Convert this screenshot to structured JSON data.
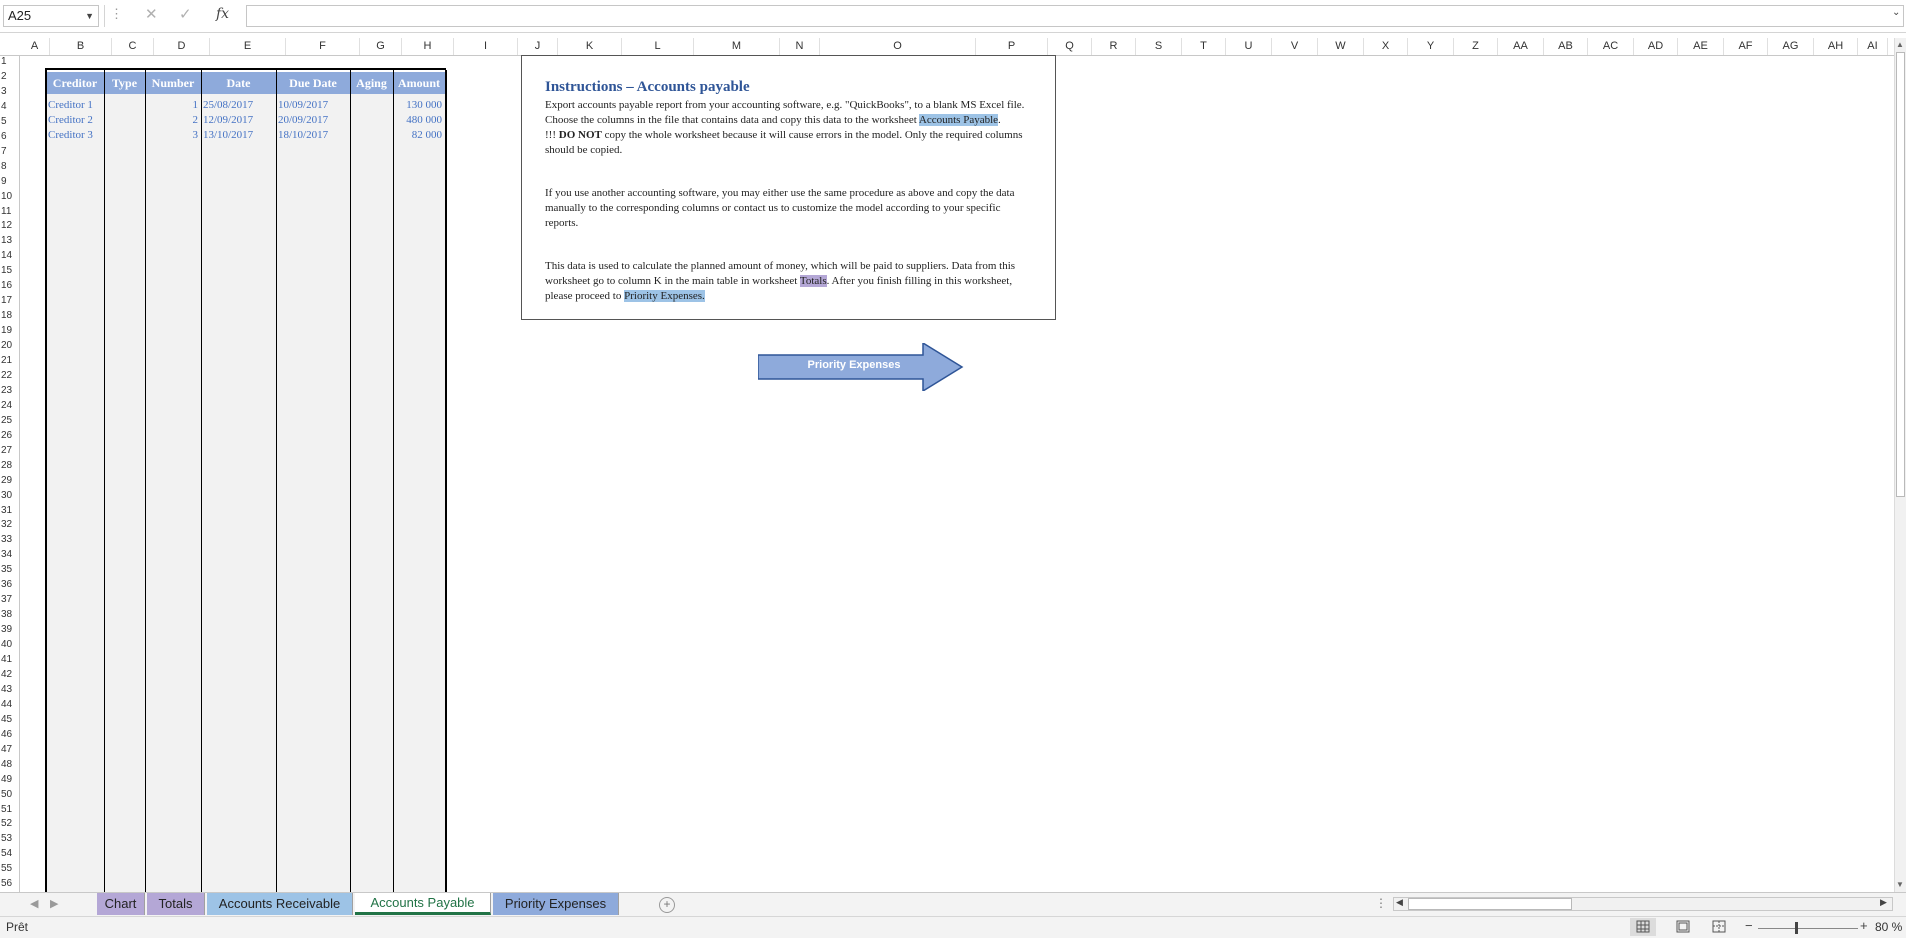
{
  "formula_bar": {
    "name_box": "A25",
    "cancel_icon": "✕",
    "enter_icon": "✓",
    "fx_label": "fx",
    "formula_value": ""
  },
  "columns": [
    "A",
    "B",
    "C",
    "D",
    "E",
    "F",
    "G",
    "H",
    "I",
    "J",
    "K",
    "L",
    "M",
    "N",
    "O",
    "P",
    "Q",
    "R",
    "S",
    "T",
    "U",
    "V",
    "W",
    "X",
    "Y",
    "Z",
    "AA",
    "AB",
    "AC",
    "AD",
    "AE",
    "AF",
    "AG",
    "AH",
    "AI"
  ],
  "rows": [
    1,
    2,
    3,
    4,
    5,
    6,
    7,
    8,
    9,
    10,
    11,
    12,
    13,
    14,
    15,
    16,
    17,
    18,
    19,
    20,
    21,
    22,
    23,
    24,
    25,
    26,
    27,
    28,
    29,
    30,
    31,
    32,
    33,
    34,
    35,
    36,
    37,
    38,
    39,
    40,
    41,
    42,
    43,
    44,
    45,
    46,
    47,
    48,
    49,
    50,
    51,
    52,
    53,
    54,
    55,
    56
  ],
  "table": {
    "headers": [
      "Creditor",
      "Type",
      "Number",
      "Date",
      "Due Date",
      "Aging",
      "Amount"
    ],
    "rows": [
      {
        "creditor": "Creditor 1",
        "type": "",
        "number": "1",
        "date": "25/08/2017",
        "due_date": "10/09/2017",
        "aging": "",
        "amount": "130 000"
      },
      {
        "creditor": "Creditor 2",
        "type": "",
        "number": "2",
        "date": "12/09/2017",
        "due_date": "20/09/2017",
        "aging": "",
        "amount": "480 000"
      },
      {
        "creditor": "Creditor 3",
        "type": "",
        "number": "3",
        "date": "13/10/2017",
        "due_date": "18/10/2017",
        "aging": "",
        "amount": "82 000"
      }
    ]
  },
  "instructions": {
    "title": "Instructions – Accounts payable",
    "p1_a": "Export accounts payable report from your accounting software, e.g. \"QuickBooks\", to a blank MS Excel file. Choose the columns in the file that contains data and copy this data to the worksheet ",
    "p1_link": "Accounts Payable",
    "p1_end": ".",
    "p2_a": "!!! ",
    "p2_bold": "DO NOT",
    "p2_b": " copy the whole worksheet because it will cause errors in the model. Only the required columns should be copied.",
    "p3": "If you use another accounting software, you may either use the same procedure as above and copy the data manually to the corresponding columns or contact us to customize the model according to your specific reports.",
    "p4_a": "This data is used to calculate the planned amount of money, which will be paid to suppliers. Data from this worksheet go to column K in the main table in worksheet ",
    "p4_link1": "Totals",
    "p4_b": ". After you finish filling in this worksheet, please proceed to ",
    "p4_link2": "Priority Expenses."
  },
  "arrow_button": {
    "label": "Priority Expenses"
  },
  "sheet_tabs": [
    {
      "label": "Chart",
      "color": "#b4a7d6"
    },
    {
      "label": "Totals",
      "color": "#b4a7d6"
    },
    {
      "label": "Accounts Receivable",
      "color": "#9dc3e6"
    },
    {
      "label": "Accounts Payable",
      "color": "#ffffff",
      "active": true
    },
    {
      "label": "Priority Expenses",
      "color": "#8eaadb"
    }
  ],
  "status_bar": {
    "status": "Prêt",
    "zoom_minus": "−",
    "zoom_plus": "+",
    "zoom": "80 %"
  },
  "colors": {
    "header_fill": "#8eaadb",
    "data_text": "#4472c4",
    "title": "#2f5597",
    "active_tab_accent": "#217346"
  }
}
